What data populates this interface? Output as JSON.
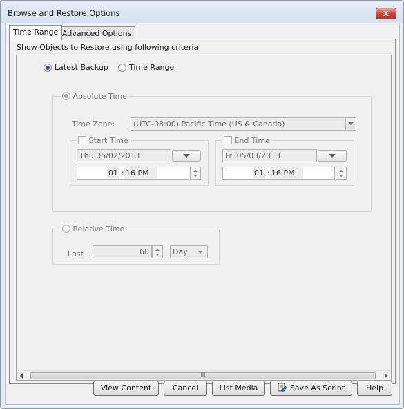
{
  "window": {
    "title": "Browse and Restore Options",
    "close_label": "x"
  },
  "tabs": [
    {
      "label": "Time Range",
      "active": true
    },
    {
      "label": "Advanced Options",
      "active": false
    }
  ],
  "criteria_label": "Show Objects to Restore using following criteria",
  "mode": {
    "latest_backup_label": "Latest Backup",
    "time_range_label": "Time Range",
    "selected": "Latest Backup"
  },
  "absolute_time": {
    "label": "Absolute Time",
    "time_zone_label": "Time Zone:",
    "time_zone_value": "(UTC-08:00) Pacific Time (US & Canada)",
    "start": {
      "label": "Start Time",
      "date": "Thu 05/02/2013",
      "hour": "01",
      "sep": ":",
      "minute_ampm": "16 PM"
    },
    "end": {
      "label": "End Time",
      "date": "Fri 05/03/2013",
      "hour": "01",
      "sep": ":",
      "minute_ampm": "16 PM"
    }
  },
  "relative_time": {
    "label": "Relative Time",
    "last_label": "Last",
    "value": "60",
    "unit": "Day"
  },
  "scrollbar": {
    "grip": "III"
  },
  "buttons": {
    "view_content": "View Content",
    "cancel": "Cancel",
    "list_media": "List Media",
    "save_as_script": "Save As Script",
    "help": "Help"
  },
  "icons": {
    "close": "close-icon",
    "save_script": "script-save-icon",
    "dropdown": "chevron-down-icon"
  }
}
